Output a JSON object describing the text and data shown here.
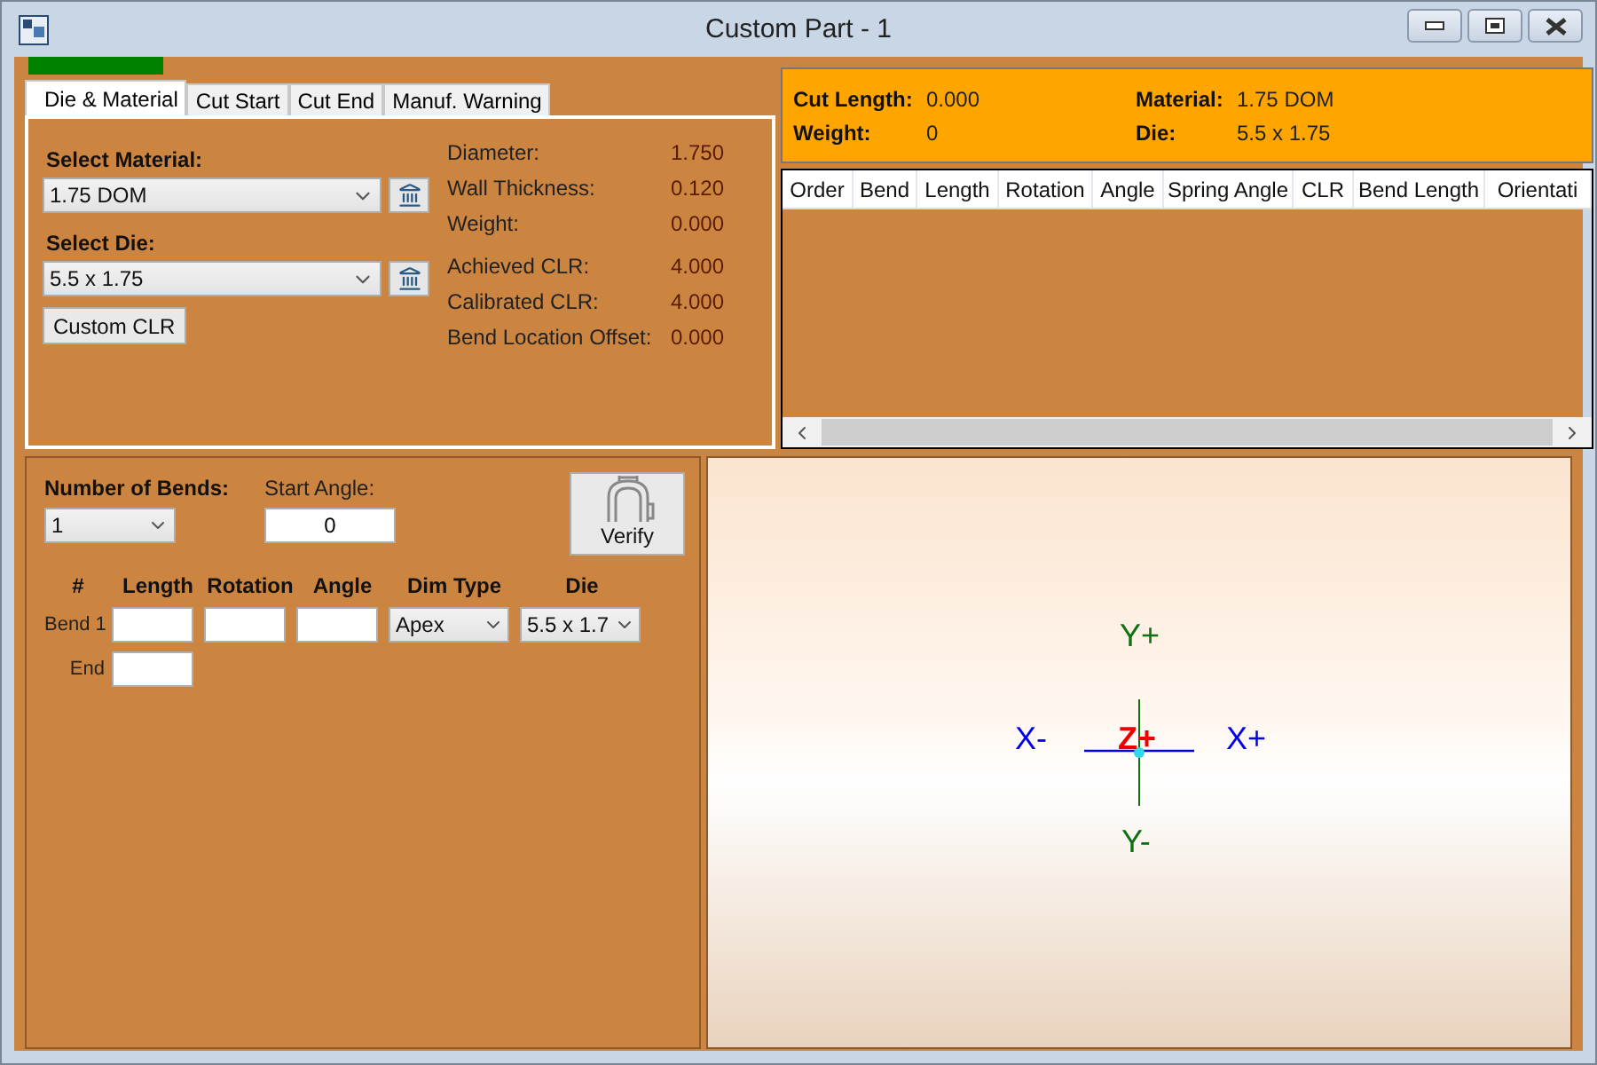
{
  "window": {
    "title": "Custom Part - 1"
  },
  "progress": {
    "level": 1
  },
  "tabs": [
    {
      "label": "Die & Material",
      "selected": true
    },
    {
      "label": "Cut Start",
      "selected": false
    },
    {
      "label": "Cut End",
      "selected": false
    },
    {
      "label": "Manuf. Warning",
      "selected": false
    }
  ],
  "material_panel": {
    "material_label": "Select Material:",
    "material_value": "1.75 DOM",
    "die_label": "Select Die:",
    "die_value": "5.5 x 1.75",
    "custom_clr_button": "Custom CLR",
    "property_groups": [
      [
        {
          "label": "Diameter:",
          "value": "1.750"
        },
        {
          "label": "Wall Thickness:",
          "value": "0.120"
        },
        {
          "label": "Weight:",
          "value": "0.000"
        }
      ],
      [
        {
          "label": "Achieved CLR:",
          "value": "4.000"
        },
        {
          "label": "Calibrated CLR:",
          "value": "4.000"
        },
        {
          "label": "Bend Location Offset:",
          "value": "0.000"
        }
      ]
    ]
  },
  "summary": [
    {
      "label": "Cut Length:",
      "value": "0.000"
    },
    {
      "label": "Material:",
      "value": "1.75 DOM"
    },
    {
      "label": "Weight:",
      "value": "0"
    },
    {
      "label": "Die:",
      "value": "5.5 x 1.75"
    }
  ],
  "grid": {
    "columns": [
      "Order",
      "Bend",
      "Length",
      "Rotation",
      "Angle",
      "Spring Angle",
      "CLR",
      "Bend Length",
      "Orientati"
    ]
  },
  "bends_panel": {
    "number_of_bends_label": "Number of Bends:",
    "number_of_bends": "1",
    "start_angle_label": "Start Angle:",
    "start_angle": "0",
    "verify_button": "Verify",
    "columns": [
      "#",
      "Length",
      "Rotation",
      "Angle",
      "Dim Type",
      "Die"
    ],
    "rows": [
      {
        "kind": "bend",
        "label": "Bend 1",
        "dim_type": "Apex",
        "die": "5.5 x 1.7"
      },
      {
        "kind": "end",
        "label": "End"
      }
    ]
  },
  "view": {
    "y_plus": "Y+",
    "x_minus": "X-",
    "x_plus": "X+",
    "y_minus": "Y-",
    "z_plus": "Z+"
  }
}
